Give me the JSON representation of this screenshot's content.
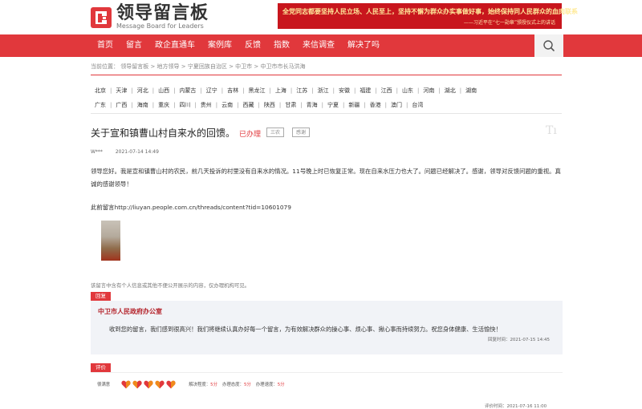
{
  "header": {
    "logo_cn": "领导留言板",
    "logo_en": "Message Board for Leaders",
    "banner_line1": "全党同志都要坚持人民立场、人民至上，坚持不懈为群众办实事做好事，始终保持同人民群众的血肉联系",
    "banner_line2": "——习近平在“七一勋章”颁授仪式上的讲话"
  },
  "nav": {
    "items": [
      "首页",
      "留言",
      "政企直通车",
      "案例库",
      "反馈",
      "指数",
      "来信调查",
      "解决了吗"
    ]
  },
  "breadcrumb": "当前位置： 领导留言板 > 地方领导 > 宁夏回族自治区 > 中卫市 > 中卫市市长马洪海",
  "regions": {
    "row1": [
      "北京",
      "天津",
      "河北",
      "山西",
      "内蒙古",
      "辽宁",
      "吉林",
      "黑龙江",
      "上海",
      "江苏",
      "浙江",
      "安徽",
      "福建",
      "江西",
      "山东",
      "河南",
      "湖北",
      "湖南"
    ],
    "row2": [
      "广东",
      "广西",
      "海南",
      "重庆",
      "四川",
      "贵州",
      "云南",
      "西藏",
      "陕西",
      "甘肃",
      "青海",
      "宁夏",
      "新疆",
      "香港",
      "澳门",
      "台湾"
    ]
  },
  "post": {
    "title": "关于宣和镇曹山村自来水的回馈。",
    "status": "已办理",
    "tags": [
      "三农",
      "感谢"
    ],
    "author": "W***",
    "time": "2021-07-14 14:49",
    "body": "领导您好。我是宣和镇曹山村的农民，前几天投诉的村里没有自来水的情况。11号晚上时已恢复正常。现在自来水压力也大了。问题已经解决了。感谢，领导对反馈问题的重视。真诚的感谢领导！",
    "link": "此前留言http://liuyan.people.com.cn/threads/content?tid=10601079",
    "notice": "该留言中含有个人信息或其他不便公开展示的内容，仅办理机构可见。"
  },
  "reply": {
    "tab": "回复",
    "org": "中卫市人民政府办公室",
    "text": "收到您的留言，我们感到很高兴！我们将继续认真办好每一个留言，为有效解决群众的操心事、烦心事、揪心事而持续努力。祝您身体健康、生活愉快！",
    "time": "回复时间：2021-07-15 14:45"
  },
  "evaluation": {
    "tab": "评价",
    "user": "很满意",
    "hearts": 5,
    "scores": [
      {
        "label": "解决程度：",
        "value": "5分"
      },
      {
        "label": "办理态度：",
        "value": "5分"
      },
      {
        "label": "办理速度：",
        "value": "5分"
      }
    ],
    "time": "评价时间：2021-07-16 11:00"
  },
  "colors": {
    "brand_red": "#e1383c",
    "banner_red": "#c8161d"
  }
}
